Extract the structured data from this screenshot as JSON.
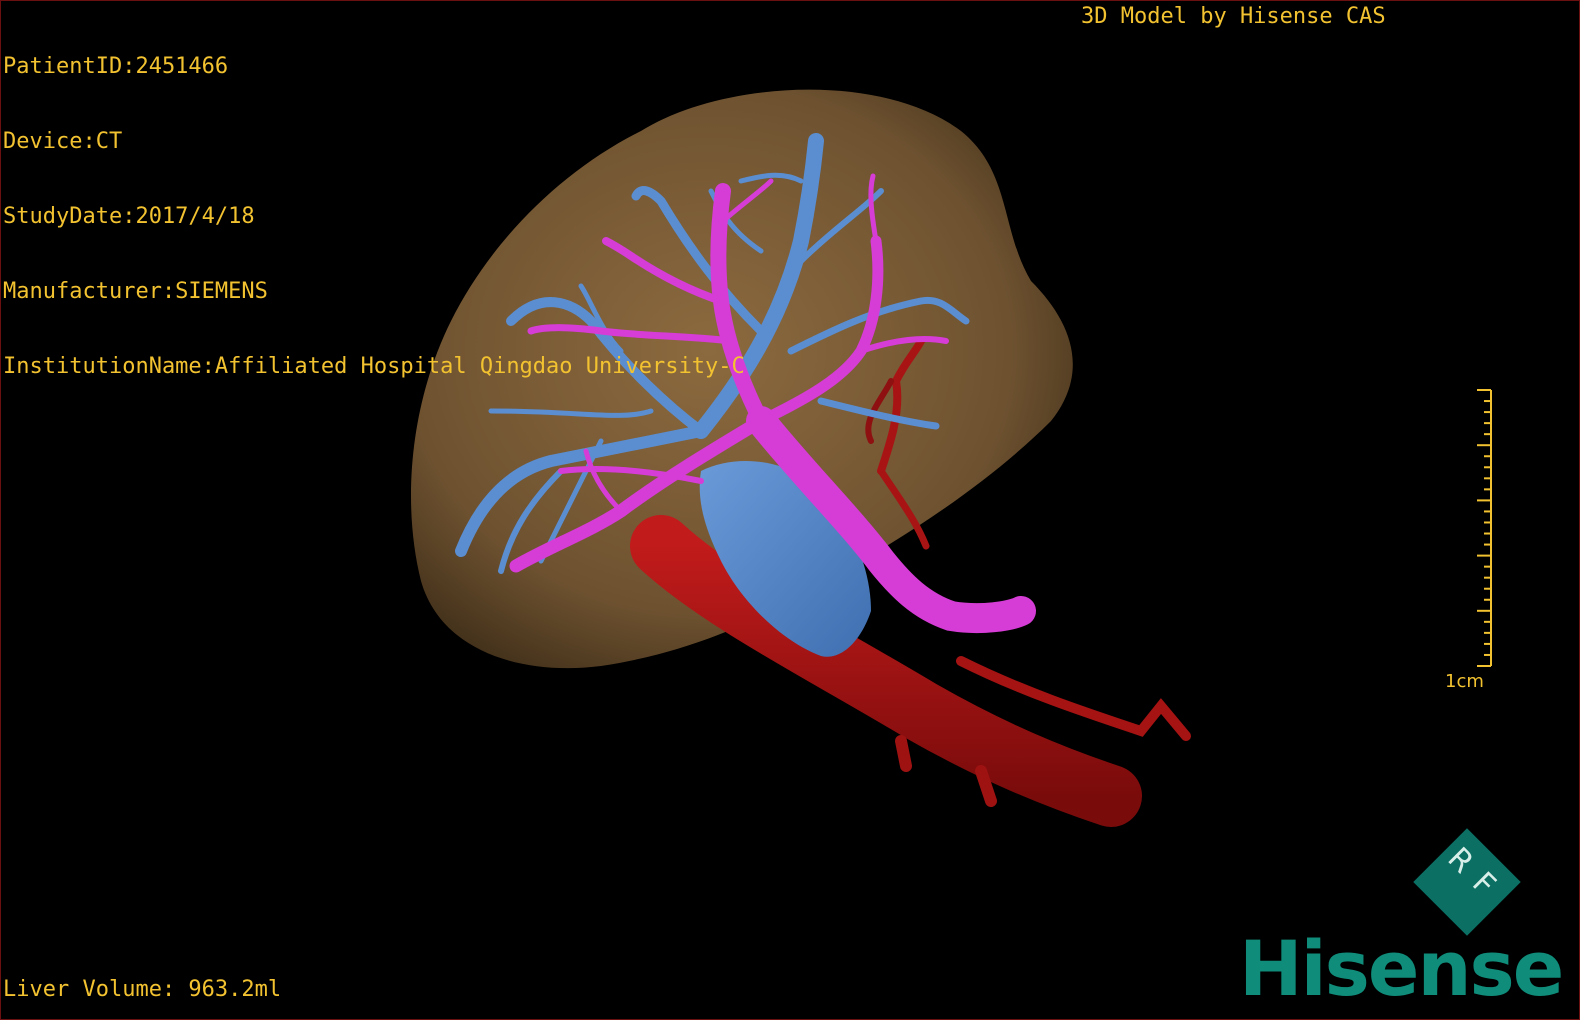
{
  "patient_info": {
    "patient_id": "PatientID:2451466",
    "device": "Device:CT",
    "study_date": "StudyDate:2017/4/18",
    "manufacturer": "Manufacturer:SIEMENS",
    "institution": "InstitutionName:Affiliated Hospital Qingdao University-C"
  },
  "title": "3D Model by Hisense CAS",
  "liver_volume": "Liver Volume: 963.2ml",
  "scale_bar": {
    "label": "1cm"
  },
  "logo": {
    "badge": "RF",
    "brand": "Hisense"
  },
  "colors": {
    "overlay_text": "#f2c230",
    "liver": "#7a5a35",
    "portal_vein": "#5b8ed0",
    "hepatic_vein": "#d63cd6",
    "artery": "#b01818",
    "brand": "#0f8c7a"
  }
}
